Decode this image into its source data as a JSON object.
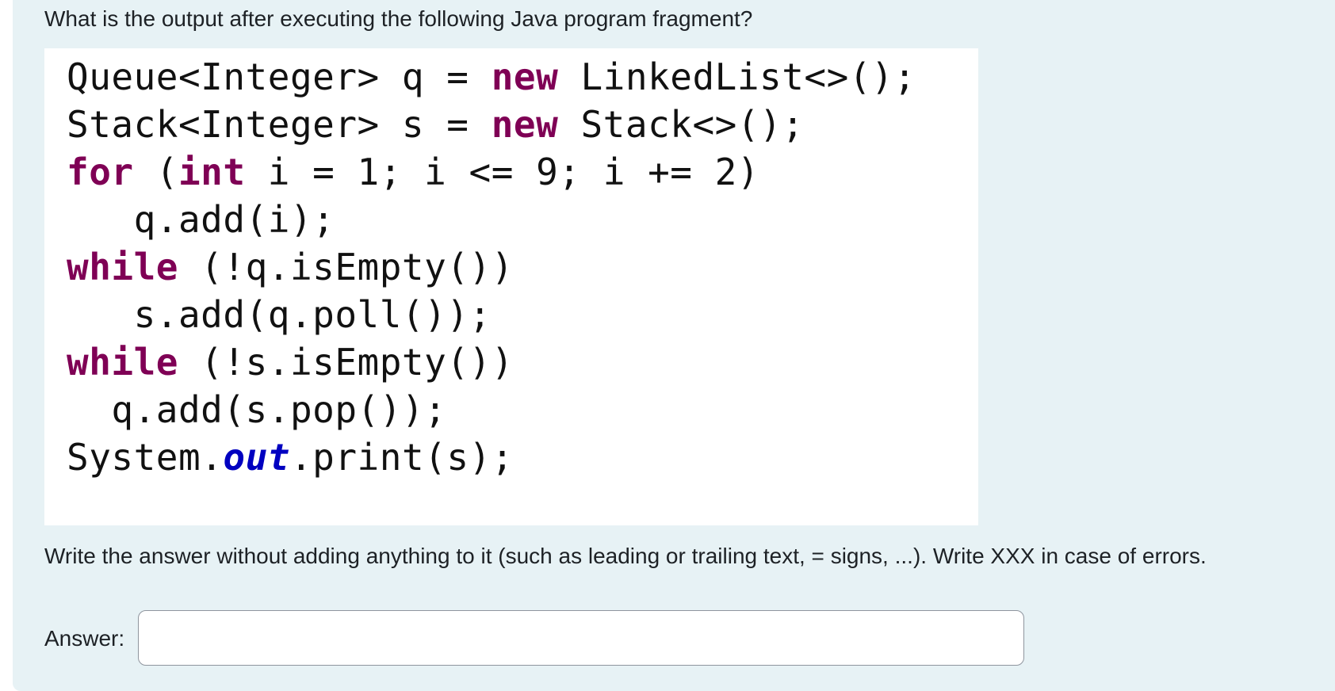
{
  "question": {
    "text": "What is the output after executing the following Java program fragment?"
  },
  "code": {
    "lines": [
      {
        "pre": "",
        "k1": "",
        "mid": "Queue<Integer> q = ",
        "k2": "new",
        "post": " LinkedList<>();"
      },
      {
        "pre": "",
        "k1": "",
        "mid": "Stack<Integer> s = ",
        "k2": "new",
        "post": " Stack<>();"
      },
      {
        "pre": "",
        "k1": "for",
        "mid": " (",
        "k2": "int",
        "post": " i = 1; i <= 9; i += 2)"
      },
      {
        "pre": "   ",
        "k1": "",
        "mid": "q.add(i);",
        "k2": "",
        "post": ""
      },
      {
        "pre": "",
        "k1": "while",
        "mid": " (!q.isEmpty())",
        "k2": "",
        "post": ""
      },
      {
        "pre": "   ",
        "k1": "",
        "mid": "s.add(q.poll());",
        "k2": "",
        "post": ""
      },
      {
        "pre": "",
        "k1": "while",
        "mid": " (!s.isEmpty())",
        "k2": "",
        "post": ""
      },
      {
        "pre": "  ",
        "k1": "",
        "mid": "q.add(s.pop());",
        "k2": "",
        "post": ""
      },
      {
        "pre": "",
        "k1": "",
        "mid": "System.",
        "k2": "",
        "post": "",
        "field": "out",
        "tail": ".print(s);"
      }
    ]
  },
  "instructions": {
    "text": "Write the answer without adding anything to it (such as leading or trailing text, = signs, ...). Write XXX in case of errors."
  },
  "answer": {
    "label": "Answer:",
    "value": "",
    "placeholder": ""
  },
  "colors": {
    "panel_bg": "#e7f2f5",
    "keyword": "#7f0055",
    "field": "#0000c0",
    "text": "#1d2125"
  }
}
